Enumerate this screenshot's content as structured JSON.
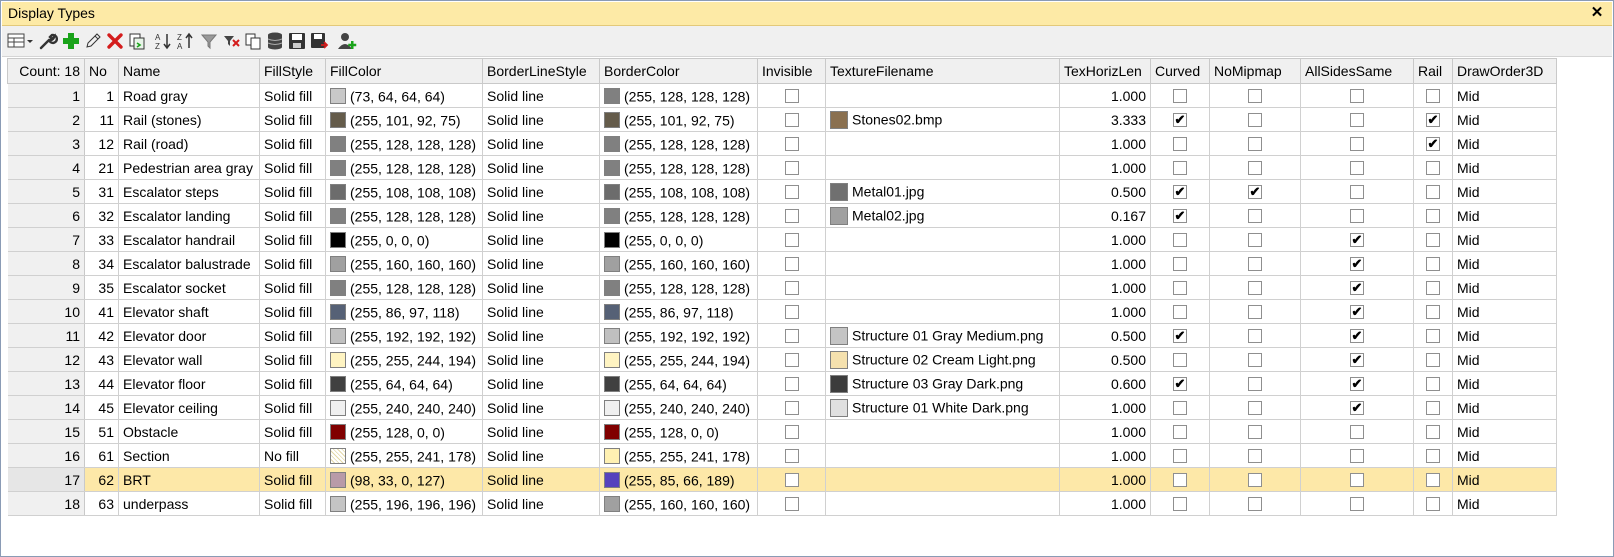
{
  "window": {
    "title": "Display Types",
    "close_glyph": "✕"
  },
  "toolbar": {
    "buttons": [
      {
        "name": "grid-menu-icon"
      },
      {
        "name": "wrench-icon"
      },
      {
        "name": "add-icon"
      },
      {
        "name": "edit-pencil-icon"
      },
      {
        "name": "delete-icon"
      },
      {
        "name": "copy-paste-icon"
      },
      {
        "name": "sort-ascending-icon"
      },
      {
        "name": "sort-descending-icon"
      },
      {
        "name": "clear-filter-icon"
      },
      {
        "name": "filter-off-icon"
      },
      {
        "name": "copy-icon"
      },
      {
        "name": "database-icon"
      },
      {
        "name": "save-icon"
      },
      {
        "name": "save-as-icon"
      },
      {
        "name": "add-user-icon"
      }
    ]
  },
  "grid": {
    "columns": [
      "Count: 18",
      "No",
      "Name",
      "FillStyle",
      "FillColor",
      "BorderLineStyle",
      "BorderColor",
      "Invisible",
      "TextureFilename",
      "TexHorizLen",
      "Curved",
      "NoMipmap",
      "AllSidesSame",
      "Rail",
      "DrawOrder3D"
    ],
    "selected_row": 16,
    "rows": [
      {
        "idx": "1",
        "no": "1",
        "name": "Road gray",
        "fill_style": "Solid fill",
        "fill_color_text": "(73, 64, 64, 64)",
        "fill_swatch": "#c8c8c8",
        "border_style": "Solid line",
        "border_color_text": "(255, 128, 128, 128)",
        "border_swatch": "#808080",
        "invisible": false,
        "texture": "",
        "tex_swatch": "",
        "tex_len": "1.000",
        "curved": false,
        "nomipmap": false,
        "allsides": false,
        "rail": false,
        "draw_order": "Mid"
      },
      {
        "idx": "2",
        "no": "11",
        "name": "Rail (stones)",
        "fill_style": "Solid fill",
        "fill_color_text": "(255, 101, 92, 75)",
        "fill_swatch": "#655c4b",
        "border_style": "Solid line",
        "border_color_text": "(255, 101, 92, 75)",
        "border_swatch": "#655c4b",
        "invisible": false,
        "texture": "Stones02.bmp",
        "tex_swatch": "#8a7050",
        "tex_len": "3.333",
        "curved": true,
        "nomipmap": false,
        "allsides": false,
        "rail": true,
        "draw_order": "Mid"
      },
      {
        "idx": "3",
        "no": "12",
        "name": "Rail (road)",
        "fill_style": "Solid fill",
        "fill_color_text": "(255, 128, 128, 128)",
        "fill_swatch": "#808080",
        "border_style": "Solid line",
        "border_color_text": "(255, 128, 128, 128)",
        "border_swatch": "#808080",
        "invisible": false,
        "texture": "",
        "tex_swatch": "",
        "tex_len": "1.000",
        "curved": false,
        "nomipmap": false,
        "allsides": false,
        "rail": true,
        "draw_order": "Mid"
      },
      {
        "idx": "4",
        "no": "21",
        "name": "Pedestrian area gray",
        "fill_style": "Solid fill",
        "fill_color_text": "(255, 128, 128, 128)",
        "fill_swatch": "#808080",
        "border_style": "Solid line",
        "border_color_text": "(255, 128, 128, 128)",
        "border_swatch": "#808080",
        "invisible": false,
        "texture": "",
        "tex_swatch": "",
        "tex_len": "1.000",
        "curved": false,
        "nomipmap": false,
        "allsides": false,
        "rail": false,
        "draw_order": "Mid"
      },
      {
        "idx": "5",
        "no": "31",
        "name": "Escalator steps",
        "fill_style": "Solid fill",
        "fill_color_text": "(255, 108, 108, 108)",
        "fill_swatch": "#6c6c6c",
        "border_style": "Solid line",
        "border_color_text": "(255, 108, 108, 108)",
        "border_swatch": "#6c6c6c",
        "invisible": false,
        "texture": "Metal01.jpg",
        "tex_swatch": "#707070",
        "tex_len": "0.500",
        "curved": true,
        "nomipmap": true,
        "allsides": false,
        "rail": false,
        "draw_order": "Mid"
      },
      {
        "idx": "6",
        "no": "32",
        "name": "Escalator landing",
        "fill_style": "Solid fill",
        "fill_color_text": "(255, 128, 128, 128)",
        "fill_swatch": "#808080",
        "border_style": "Solid line",
        "border_color_text": "(255, 128, 128, 128)",
        "border_swatch": "#808080",
        "invisible": false,
        "texture": "Metal02.jpg",
        "tex_swatch": "#a0a0a0",
        "tex_len": "0.167",
        "curved": true,
        "nomipmap": false,
        "allsides": false,
        "rail": false,
        "draw_order": "Mid"
      },
      {
        "idx": "7",
        "no": "33",
        "name": "Escalator handrail",
        "fill_style": "Solid fill",
        "fill_color_text": "(255, 0, 0, 0)",
        "fill_swatch": "#000000",
        "border_style": "Solid line",
        "border_color_text": "(255, 0, 0, 0)",
        "border_swatch": "#000000",
        "invisible": false,
        "texture": "",
        "tex_swatch": "",
        "tex_len": "1.000",
        "curved": false,
        "nomipmap": false,
        "allsides": true,
        "rail": false,
        "draw_order": "Mid"
      },
      {
        "idx": "8",
        "no": "34",
        "name": "Escalator balustrade",
        "fill_style": "Solid fill",
        "fill_color_text": "(255, 160, 160, 160)",
        "fill_swatch": "#a0a0a0",
        "border_style": "Solid line",
        "border_color_text": "(255, 160, 160, 160)",
        "border_swatch": "#a0a0a0",
        "invisible": false,
        "texture": "",
        "tex_swatch": "",
        "tex_len": "1.000",
        "curved": false,
        "nomipmap": false,
        "allsides": true,
        "rail": false,
        "draw_order": "Mid"
      },
      {
        "idx": "9",
        "no": "35",
        "name": "Escalator socket",
        "fill_style": "Solid fill",
        "fill_color_text": "(255, 128, 128, 128)",
        "fill_swatch": "#808080",
        "border_style": "Solid line",
        "border_color_text": "(255, 128, 128, 128)",
        "border_swatch": "#808080",
        "invisible": false,
        "texture": "",
        "tex_swatch": "",
        "tex_len": "1.000",
        "curved": false,
        "nomipmap": false,
        "allsides": true,
        "rail": false,
        "draw_order": "Mid"
      },
      {
        "idx": "10",
        "no": "41",
        "name": "Elevator shaft",
        "fill_style": "Solid fill",
        "fill_color_text": "(255, 86, 97, 118)",
        "fill_swatch": "#566176",
        "border_style": "Solid line",
        "border_color_text": "(255, 86, 97, 118)",
        "border_swatch": "#566176",
        "invisible": false,
        "texture": "",
        "tex_swatch": "",
        "tex_len": "1.000",
        "curved": false,
        "nomipmap": false,
        "allsides": true,
        "rail": false,
        "draw_order": "Mid"
      },
      {
        "idx": "11",
        "no": "42",
        "name": "Elevator door",
        "fill_style": "Solid fill",
        "fill_color_text": "(255, 192, 192, 192)",
        "fill_swatch": "#c0c0c0",
        "border_style": "Solid line",
        "border_color_text": "(255, 192, 192, 192)",
        "border_swatch": "#c0c0c0",
        "invisible": false,
        "texture": "Structure 01 Gray Medium.png",
        "tex_swatch": "#c4c4c4",
        "tex_len": "0.500",
        "curved": true,
        "nomipmap": false,
        "allsides": true,
        "rail": false,
        "draw_order": "Mid"
      },
      {
        "idx": "12",
        "no": "43",
        "name": "Elevator wall",
        "fill_style": "Solid fill",
        "fill_color_text": "(255, 255, 244, 194)",
        "fill_swatch": "#fff4c2",
        "border_style": "Solid line",
        "border_color_text": "(255, 255, 244, 194)",
        "border_swatch": "#fff4c2",
        "invisible": false,
        "texture": "Structure 02 Cream Light.png",
        "tex_swatch": "#f5e1ae",
        "tex_len": "0.500",
        "curved": false,
        "nomipmap": false,
        "allsides": true,
        "rail": false,
        "draw_order": "Mid"
      },
      {
        "idx": "13",
        "no": "44",
        "name": "Elevator floor",
        "fill_style": "Solid fill",
        "fill_color_text": "(255, 64, 64, 64)",
        "fill_swatch": "#404040",
        "border_style": "Solid line",
        "border_color_text": "(255, 64, 64, 64)",
        "border_swatch": "#404040",
        "invisible": false,
        "texture": "Structure 03 Gray Dark.png",
        "tex_swatch": "#3c3c3c",
        "tex_len": "0.600",
        "curved": true,
        "nomipmap": false,
        "allsides": true,
        "rail": false,
        "draw_order": "Mid"
      },
      {
        "idx": "14",
        "no": "45",
        "name": "Elevator ceiling",
        "fill_style": "Solid fill",
        "fill_color_text": "(255, 240, 240, 240)",
        "fill_swatch": "#f0f0f0",
        "border_style": "Solid line",
        "border_color_text": "(255, 240, 240, 240)",
        "border_swatch": "#f0f0f0",
        "invisible": false,
        "texture": "Structure 01 White Dark.png",
        "tex_swatch": "#e0e0e0",
        "tex_len": "1.000",
        "curved": false,
        "nomipmap": false,
        "allsides": true,
        "rail": false,
        "draw_order": "Mid"
      },
      {
        "idx": "15",
        "no": "51",
        "name": "Obstacle",
        "fill_style": "Solid fill",
        "fill_color_text": "(255, 128, 0, 0)",
        "fill_swatch": "#800000",
        "border_style": "Solid line",
        "border_color_text": "(255, 128, 0, 0)",
        "border_swatch": "#800000",
        "invisible": false,
        "texture": "",
        "tex_swatch": "",
        "tex_len": "1.000",
        "curved": false,
        "nomipmap": false,
        "allsides": false,
        "rail": false,
        "draw_order": "Mid"
      },
      {
        "idx": "16",
        "no": "61",
        "name": "Section",
        "fill_style": "No fill",
        "fill_color_text": "(255, 255, 241, 178)",
        "fill_swatch": "#fff1b2",
        "fill_hatched": true,
        "border_style": "Solid line",
        "border_color_text": "(255, 255, 241, 178)",
        "border_swatch": "#fff1b2",
        "invisible": false,
        "texture": "",
        "tex_swatch": "",
        "tex_len": "1.000",
        "curved": false,
        "nomipmap": false,
        "allsides": false,
        "rail": false,
        "draw_order": "Mid"
      },
      {
        "idx": "17",
        "no": "62",
        "name": "BRT",
        "fill_style": "Solid fill",
        "fill_color_text": "(98, 33, 0, 127)",
        "fill_swatch": "#b89aa8",
        "border_style": "Solid line",
        "border_color_text": "(255, 85, 66, 189)",
        "border_swatch": "#5542bd",
        "invisible": false,
        "texture": "",
        "tex_swatch": "",
        "tex_len": "1.000",
        "curved": false,
        "nomipmap": false,
        "allsides": false,
        "rail": false,
        "draw_order": "Mid"
      },
      {
        "idx": "18",
        "no": "63",
        "name": "underpass",
        "fill_style": "Solid fill",
        "fill_color_text": "(255, 196, 196, 196)",
        "fill_swatch": "#c4c4c4",
        "border_style": "Solid line",
        "border_color_text": "(255, 160, 160, 160)",
        "border_swatch": "#a0a0a0",
        "invisible": false,
        "texture": "",
        "tex_swatch": "",
        "tex_len": "1.000",
        "curved": false,
        "nomipmap": false,
        "allsides": false,
        "rail": false,
        "draw_order": "Mid"
      }
    ]
  },
  "colors": {
    "title_bg": "#fdeaa6",
    "selected_row_bg": "#fde8a8",
    "header_bg": "#f0f0f0"
  }
}
